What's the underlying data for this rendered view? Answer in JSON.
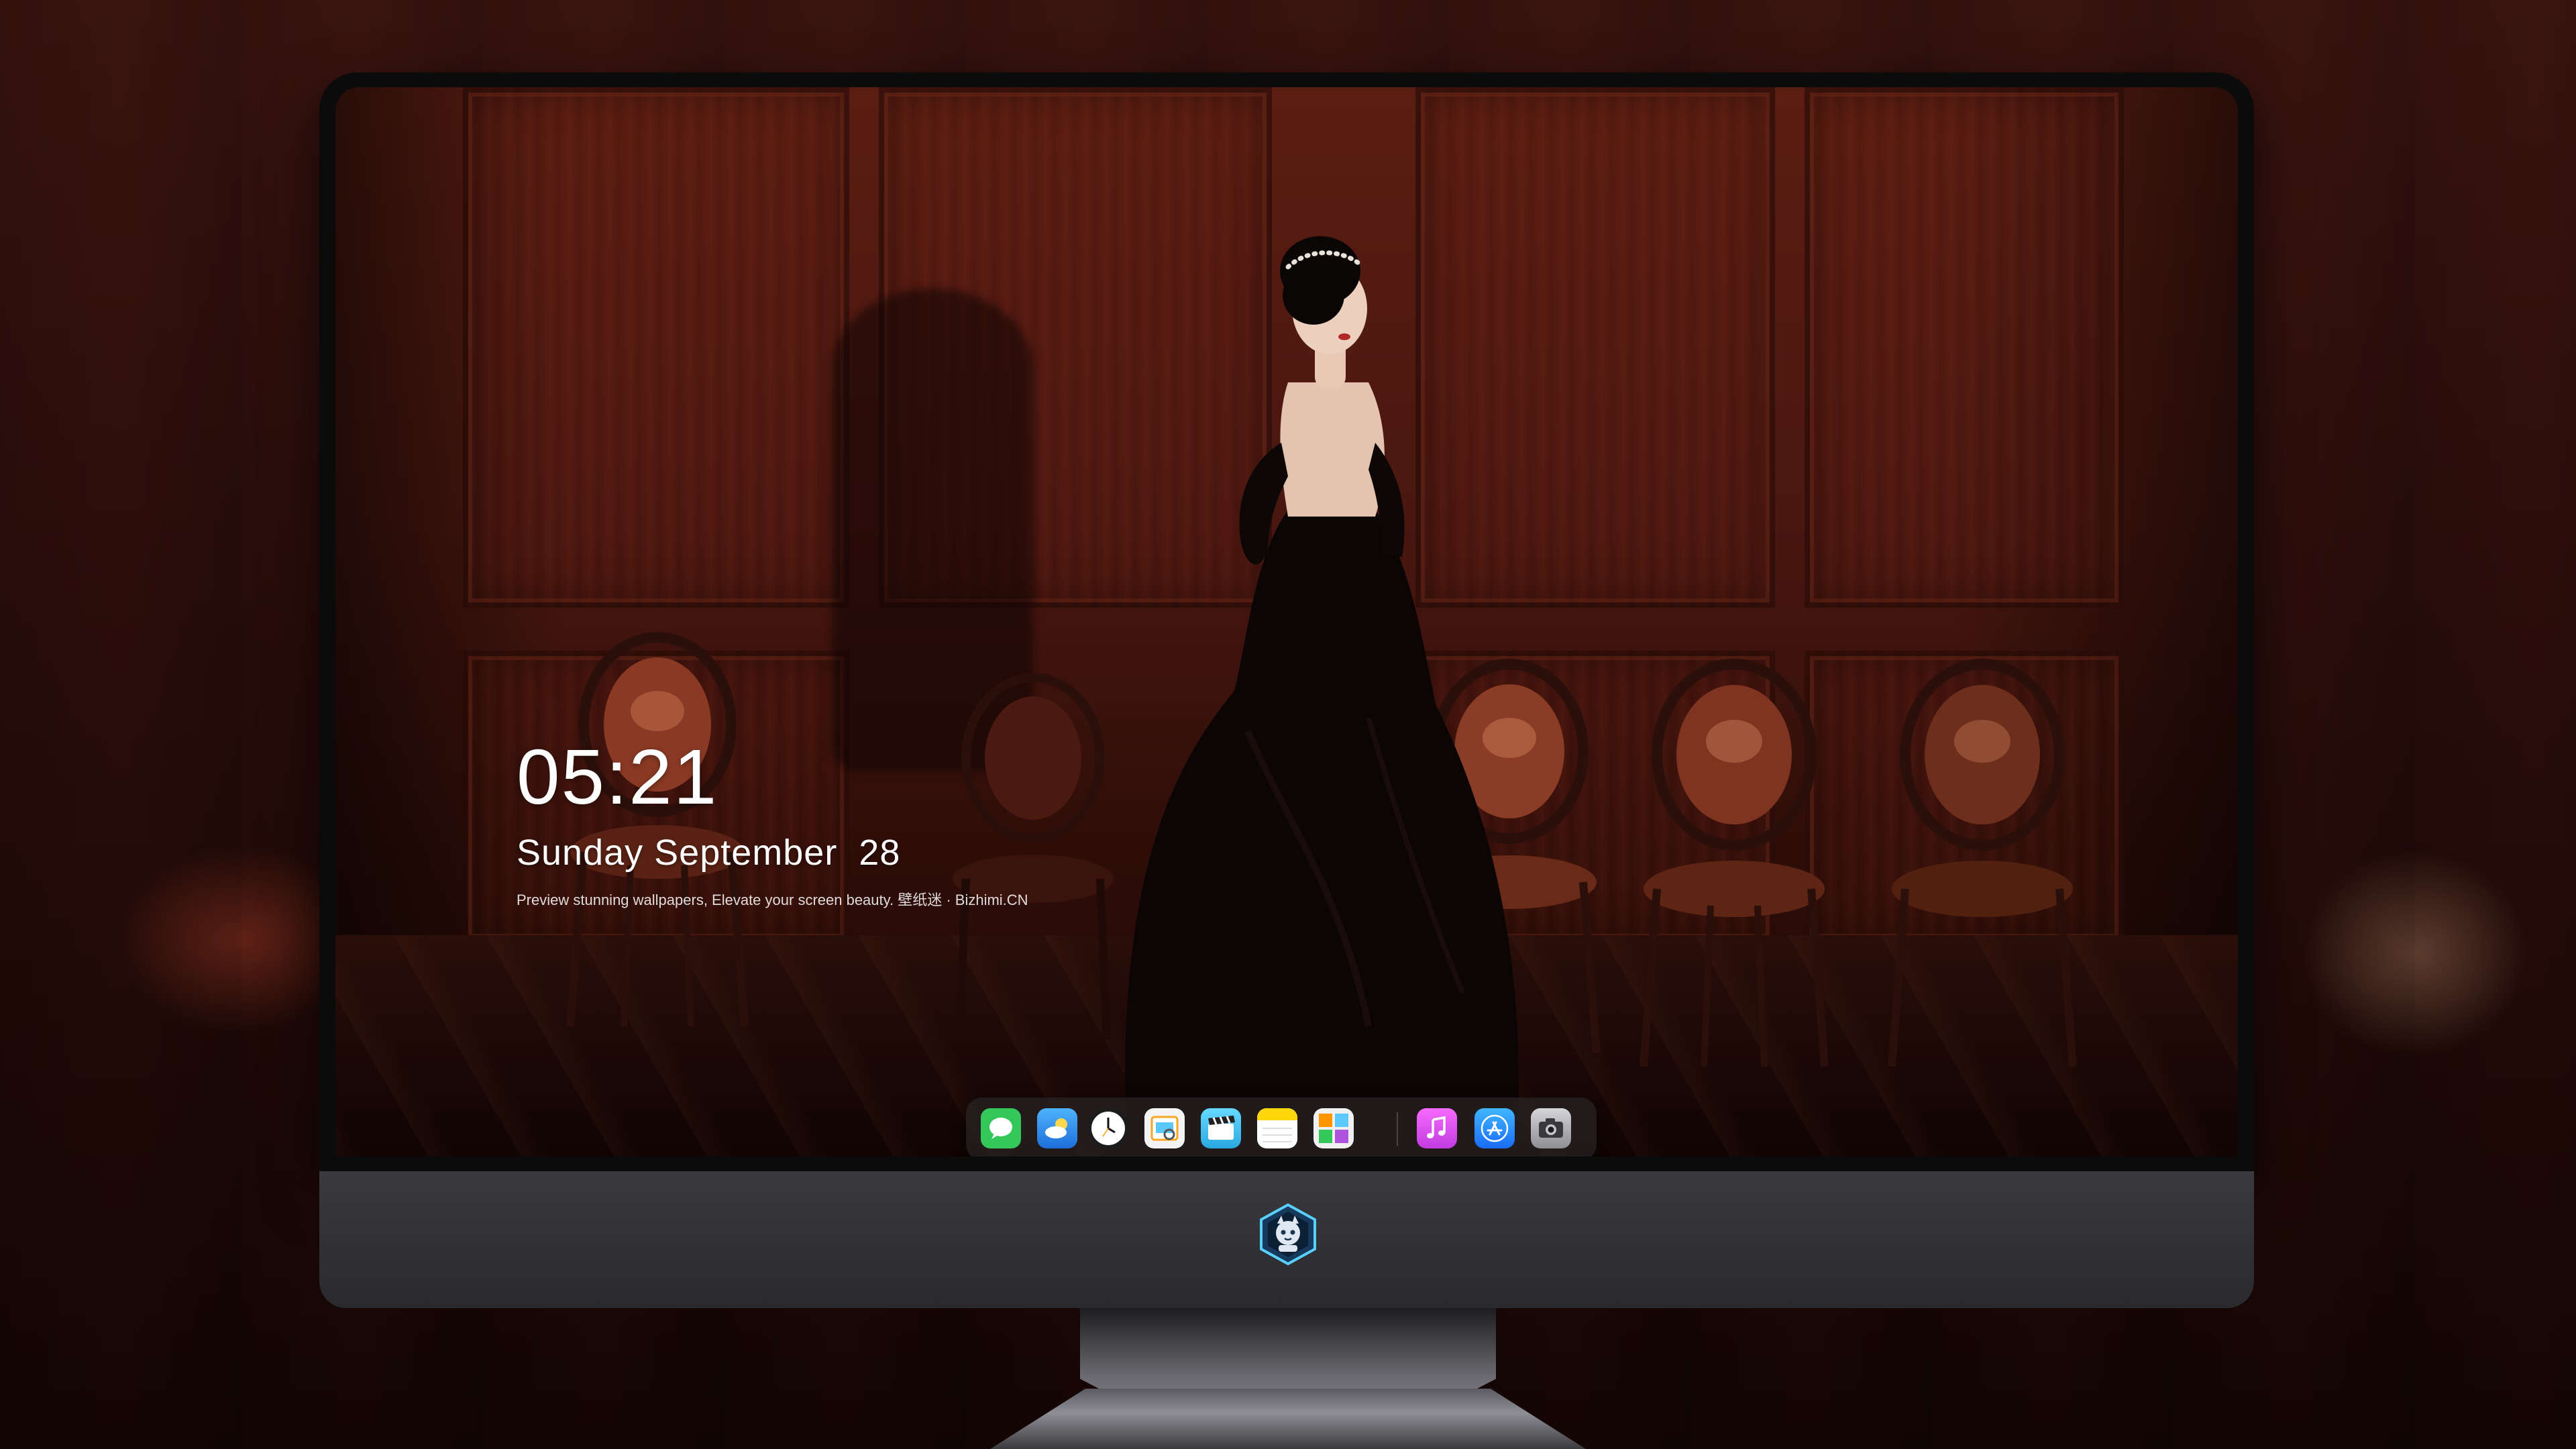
{
  "lockscreen": {
    "time": "05:21",
    "date": "Sunday September  28",
    "caption": "Preview stunning wallpapers, Elevate your screen beauty. 壁纸迷 · Bizhimi.CN"
  },
  "dock": {
    "apps": [
      {
        "icon": "messages-icon",
        "color": "#34c759"
      },
      {
        "icon": "weather-icon",
        "color": "#1e88e5"
      },
      {
        "icon": "clock-icon",
        "color": "#ffffff"
      },
      {
        "icon": "preview-icon",
        "color": "#f5c542"
      },
      {
        "icon": "clips-icon",
        "color": "#5ac8fa"
      },
      {
        "icon": "notes-icon",
        "color": "#ffd60a"
      },
      {
        "icon": "photo-booth-icon",
        "color": "#4caf50"
      },
      {
        "icon": "music-icon",
        "color": "#e040fb"
      },
      {
        "icon": "app-store-icon",
        "color": "#1e88ff"
      },
      {
        "icon": "camera-icon",
        "color": "#8e8e93"
      }
    ]
  },
  "monitor": {
    "chin_logo": "brand-logo-icon"
  }
}
